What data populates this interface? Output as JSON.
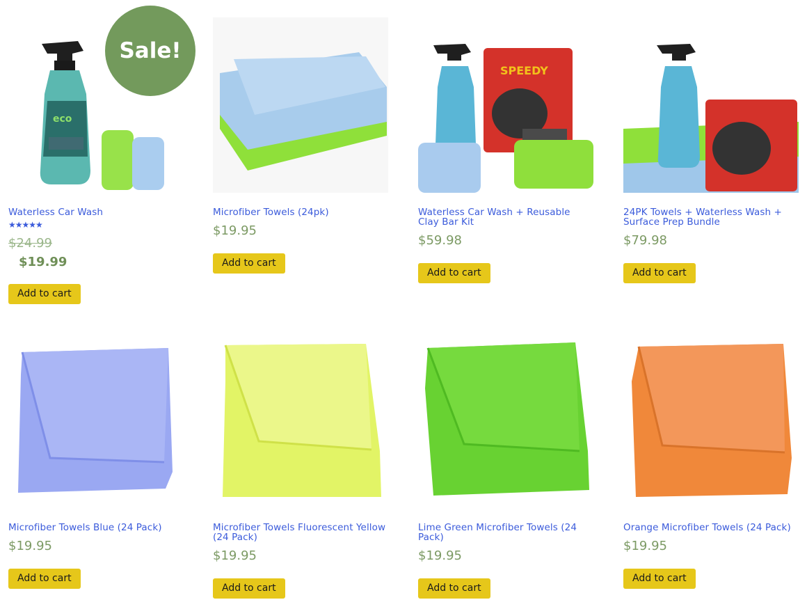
{
  "products": [
    {
      "title": "Waterless Car Wash",
      "rating_out_of_5": 5,
      "stars": "★★★★★",
      "price_old": "$24.99",
      "price": "$19.99",
      "on_sale": true,
      "sale_badge": "Sale!",
      "button": "Add to cart",
      "image": "eco-car-care-spray-bottle-with-towels"
    },
    {
      "title": "Microfiber Towels (24pk)",
      "price": "$19.95",
      "button": "Add to cart",
      "image": "stack-of-blue-and-green-towels"
    },
    {
      "title": "Waterless Car Wash + Reusable Clay Bar Kit",
      "price": "$59.98",
      "button": "Add to cart",
      "image": "spray-bottle-with-speedy-surface-prep-kit"
    },
    {
      "title": "24PK Towels + Waterless Wash + Surface Prep Bundle",
      "price": "$79.98",
      "button": "Add to cart",
      "image": "spray-bottle-towels-and-surface-prep-bundle"
    },
    {
      "title": "Microfiber Towels Blue (24 Pack)",
      "price": "$19.95",
      "button": "Add to cart",
      "image": "blue-microfiber-towel"
    },
    {
      "title": "Microfiber Towels Fluorescent Yellow (24 Pack)",
      "price": "$19.95",
      "button": "Add to cart",
      "image": "yellow-microfiber-towel"
    },
    {
      "title": "Lime Green Microfiber Towels (24 Pack)",
      "price": "$19.95",
      "button": "Add to cart",
      "image": "lime-green-microfiber-towel"
    },
    {
      "title": "Orange Microfiber Towels (24 Pack)",
      "price": "$19.95",
      "button": "Add to cart",
      "image": "orange-microfiber-towel"
    }
  ],
  "colors": {
    "title_link": "#3b5bdb",
    "price": "#7c9a64",
    "button_bg": "#e6c71a",
    "sale_badge_bg": "#739a5c",
    "towel_blue": "#8fa0f0",
    "towel_yellow": "#e4f56a",
    "towel_green": "#6fd43a",
    "towel_orange": "#f08a3e"
  }
}
